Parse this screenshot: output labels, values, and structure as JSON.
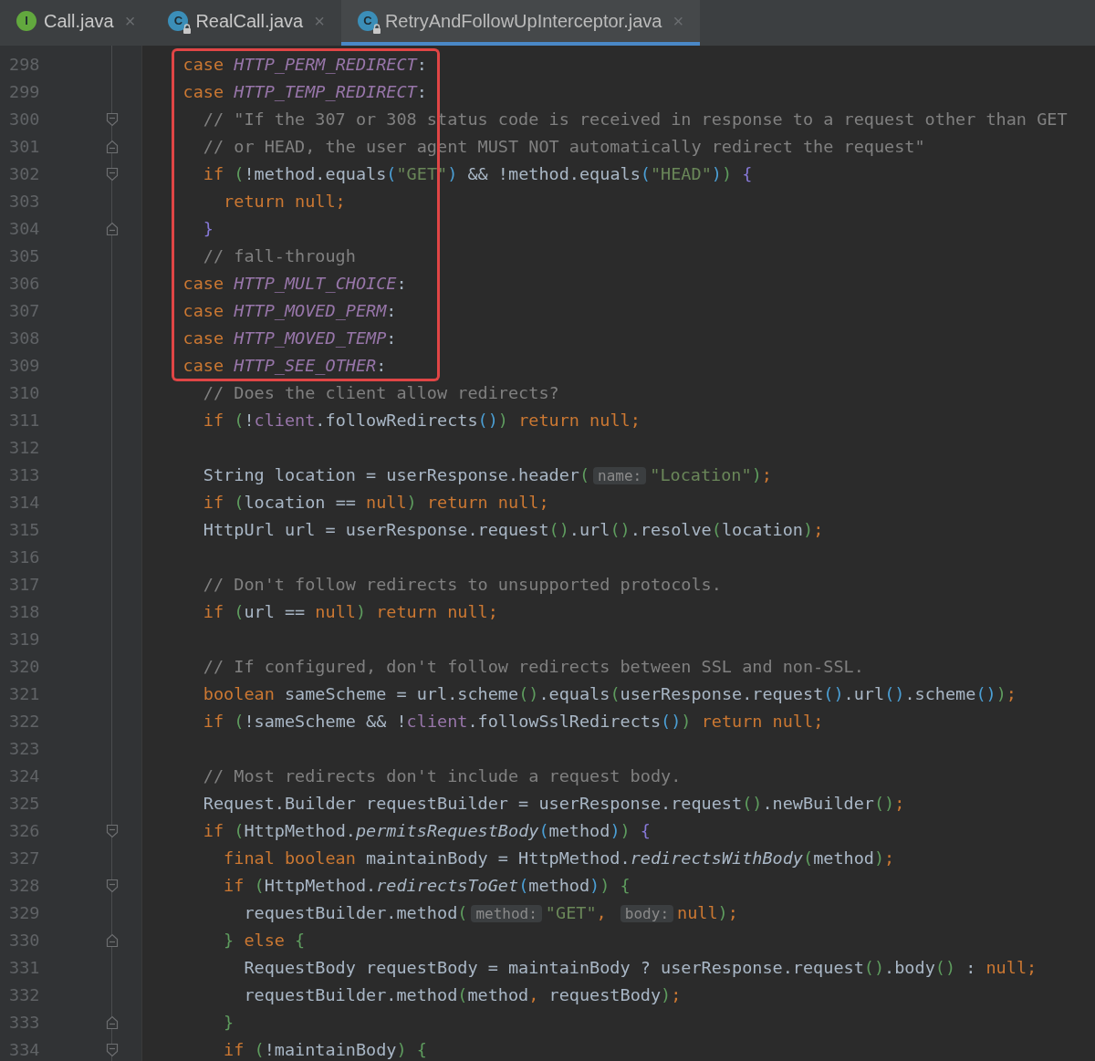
{
  "tabs": [
    {
      "label": "Call.java",
      "kind": "interface",
      "icon_letter": "I",
      "locked": false,
      "close": "×",
      "selected": false
    },
    {
      "label": "RealCall.java",
      "kind": "class",
      "icon_letter": "C",
      "locked": true,
      "close": "×",
      "selected": false
    },
    {
      "label": "RetryAndFollowUpInterceptor.java",
      "kind": "class",
      "icon_letter": "C",
      "locked": true,
      "close": "×",
      "selected": true
    }
  ],
  "lines": [
    {
      "number": "298",
      "highlighted": true,
      "tokens": [
        {
          "kind": "keyword",
          "text": "    case "
        },
        {
          "kind": "constant",
          "text": "HTTP_PERM_REDIRECT"
        },
        {
          "kind": "plain",
          "text": ":"
        }
      ]
    },
    {
      "number": "299",
      "highlighted": true,
      "tokens": [
        {
          "kind": "keyword",
          "text": "    case "
        },
        {
          "kind": "constant",
          "text": "HTTP_TEMP_REDIRECT"
        },
        {
          "kind": "plain",
          "text": ":"
        }
      ]
    },
    {
      "number": "300",
      "highlighted": true,
      "fold": {
        "kind": "open"
      },
      "tokens": [
        {
          "kind": "comment",
          "text": "      // \"If the 307 or 308 status code is received in response to a request other than GET"
        }
      ]
    },
    {
      "number": "301",
      "highlighted": true,
      "fold": {
        "kind": "close"
      },
      "tokens": [
        {
          "kind": "comment",
          "text": "      // or HEAD, the user agent MUST NOT automatically redirect the request\""
        }
      ]
    },
    {
      "number": "302",
      "highlighted": true,
      "fold": {
        "kind": "open"
      },
      "tokens": [
        {
          "kind": "keyword",
          "text": "      if "
        },
        {
          "kind": "bracket1",
          "text": "("
        },
        {
          "kind": "plain",
          "text": "!method.equals"
        },
        {
          "kind": "bracket2",
          "text": "("
        },
        {
          "kind": "string",
          "text": "\"GET\""
        },
        {
          "kind": "bracket2",
          "text": ")"
        },
        {
          "kind": "plain",
          "text": " && !method.equals"
        },
        {
          "kind": "bracket2",
          "text": "("
        },
        {
          "kind": "string",
          "text": "\"HEAD\""
        },
        {
          "kind": "bracket2",
          "text": ")"
        },
        {
          "kind": "bracket1",
          "text": ") "
        },
        {
          "kind": "bracket3",
          "text": "{"
        }
      ]
    },
    {
      "number": "303",
      "highlighted": true,
      "tokens": [
        {
          "kind": "keyword",
          "text": "        return null;"
        }
      ]
    },
    {
      "number": "304",
      "highlighted": true,
      "fold": {
        "kind": "close"
      },
      "tokens": [
        {
          "kind": "bracket3",
          "text": "      }"
        }
      ]
    },
    {
      "number": "305",
      "highlighted": true,
      "tokens": [
        {
          "kind": "comment",
          "text": "      // fall-through"
        }
      ]
    },
    {
      "number": "306",
      "highlighted": true,
      "tokens": [
        {
          "kind": "keyword",
          "text": "    case "
        },
        {
          "kind": "constant",
          "text": "HTTP_MULT_CHOICE"
        },
        {
          "kind": "plain",
          "text": ":"
        }
      ]
    },
    {
      "number": "307",
      "highlighted": true,
      "tokens": [
        {
          "kind": "keyword",
          "text": "    case "
        },
        {
          "kind": "constant",
          "text": "HTTP_MOVED_PERM"
        },
        {
          "kind": "plain",
          "text": ":"
        }
      ]
    },
    {
      "number": "308",
      "highlighted": true,
      "tokens": [
        {
          "kind": "keyword",
          "text": "    case "
        },
        {
          "kind": "constant",
          "text": "HTTP_MOVED_TEMP"
        },
        {
          "kind": "plain",
          "text": ":"
        }
      ]
    },
    {
      "number": "309",
      "highlighted": true,
      "tokens": [
        {
          "kind": "keyword",
          "text": "    case "
        },
        {
          "kind": "constant",
          "text": "HTTP_SEE_OTHER"
        },
        {
          "kind": "plain",
          "text": ":"
        }
      ]
    },
    {
      "number": "310",
      "highlighted": false,
      "tokens": [
        {
          "kind": "comment",
          "text": "      // Does the client allow redirects?"
        }
      ]
    },
    {
      "number": "311",
      "highlighted": false,
      "tokens": [
        {
          "kind": "keyword",
          "text": "      if "
        },
        {
          "kind": "bracket1",
          "text": "("
        },
        {
          "kind": "plain",
          "text": "!"
        },
        {
          "kind": "field",
          "text": "client"
        },
        {
          "kind": "plain",
          "text": ".followRedirects"
        },
        {
          "kind": "bracket2",
          "text": "()"
        },
        {
          "kind": "bracket1",
          "text": ") "
        },
        {
          "kind": "keyword",
          "text": "return null;"
        }
      ]
    },
    {
      "number": "312",
      "highlighted": false
    },
    {
      "number": "313",
      "highlighted": false,
      "tokens": [
        {
          "kind": "plain",
          "text": "      String location = userResponse.header"
        },
        {
          "kind": "bracket1",
          "text": "("
        },
        {
          "kind": "hint",
          "text": "name:"
        },
        {
          "kind": "string",
          "text": "\"Location\""
        },
        {
          "kind": "bracket1",
          "text": ")"
        },
        {
          "kind": "keyword",
          "text": ";"
        }
      ]
    },
    {
      "number": "314",
      "highlighted": false,
      "tokens": [
        {
          "kind": "keyword",
          "text": "      if "
        },
        {
          "kind": "bracket1",
          "text": "("
        },
        {
          "kind": "plain",
          "text": "location == "
        },
        {
          "kind": "keyword",
          "text": "null"
        },
        {
          "kind": "bracket1",
          "text": ") "
        },
        {
          "kind": "keyword",
          "text": "return null;"
        }
      ]
    },
    {
      "number": "315",
      "highlighted": false,
      "tokens": [
        {
          "kind": "plain",
          "text": "      HttpUrl url = userResponse.request"
        },
        {
          "kind": "bracket1",
          "text": "()"
        },
        {
          "kind": "plain",
          "text": ".url"
        },
        {
          "kind": "bracket1",
          "text": "()"
        },
        {
          "kind": "plain",
          "text": ".resolve"
        },
        {
          "kind": "bracket1",
          "text": "("
        },
        {
          "kind": "plain",
          "text": "location"
        },
        {
          "kind": "bracket1",
          "text": ")"
        },
        {
          "kind": "keyword",
          "text": ";"
        }
      ]
    },
    {
      "number": "316",
      "highlighted": false
    },
    {
      "number": "317",
      "highlighted": false,
      "tokens": [
        {
          "kind": "comment",
          "text": "      // Don't follow redirects to unsupported protocols."
        }
      ]
    },
    {
      "number": "318",
      "highlighted": false,
      "tokens": [
        {
          "kind": "keyword",
          "text": "      if "
        },
        {
          "kind": "bracket1",
          "text": "("
        },
        {
          "kind": "plain",
          "text": "url == "
        },
        {
          "kind": "keyword",
          "text": "null"
        },
        {
          "kind": "bracket1",
          "text": ") "
        },
        {
          "kind": "keyword",
          "text": "return null;"
        }
      ]
    },
    {
      "number": "319",
      "highlighted": false
    },
    {
      "number": "320",
      "highlighted": false,
      "tokens": [
        {
          "kind": "comment",
          "text": "      // If configured, don't follow redirects between SSL and non-SSL."
        }
      ]
    },
    {
      "number": "321",
      "highlighted": false,
      "tokens": [
        {
          "kind": "keyword",
          "text": "      boolean "
        },
        {
          "kind": "plain",
          "text": "sameScheme = url.scheme"
        },
        {
          "kind": "bracket1",
          "text": "()"
        },
        {
          "kind": "plain",
          "text": ".equals"
        },
        {
          "kind": "bracket1",
          "text": "("
        },
        {
          "kind": "plain",
          "text": "userResponse.request"
        },
        {
          "kind": "bracket2",
          "text": "()"
        },
        {
          "kind": "plain",
          "text": ".url"
        },
        {
          "kind": "bracket2",
          "text": "()"
        },
        {
          "kind": "plain",
          "text": ".scheme"
        },
        {
          "kind": "bracket2",
          "text": "()"
        },
        {
          "kind": "bracket1",
          "text": ")"
        },
        {
          "kind": "keyword",
          "text": ";"
        }
      ]
    },
    {
      "number": "322",
      "highlighted": false,
      "tokens": [
        {
          "kind": "keyword",
          "text": "      if "
        },
        {
          "kind": "bracket1",
          "text": "("
        },
        {
          "kind": "plain",
          "text": "!sameScheme && !"
        },
        {
          "kind": "field",
          "text": "client"
        },
        {
          "kind": "plain",
          "text": ".followSslRedirects"
        },
        {
          "kind": "bracket2",
          "text": "()"
        },
        {
          "kind": "bracket1",
          "text": ") "
        },
        {
          "kind": "keyword",
          "text": "return null;"
        }
      ]
    },
    {
      "number": "323",
      "highlighted": false
    },
    {
      "number": "324",
      "highlighted": false,
      "tokens": [
        {
          "kind": "comment",
          "text": "      // Most redirects don't include a request body."
        }
      ]
    },
    {
      "number": "325",
      "highlighted": false,
      "tokens": [
        {
          "kind": "plain",
          "text": "      Request.Builder requestBuilder = userResponse.request"
        },
        {
          "kind": "bracket1",
          "text": "()"
        },
        {
          "kind": "plain",
          "text": ".newBuilder"
        },
        {
          "kind": "bracket1",
          "text": "()"
        },
        {
          "kind": "keyword",
          "text": ";"
        }
      ]
    },
    {
      "number": "326",
      "highlighted": false,
      "fold": {
        "kind": "open"
      },
      "tokens": [
        {
          "kind": "keyword",
          "text": "      if "
        },
        {
          "kind": "bracket1",
          "text": "("
        },
        {
          "kind": "plain",
          "text": "HttpMethod."
        },
        {
          "kind": "method",
          "text": "permitsRequestBody"
        },
        {
          "kind": "bracket2",
          "text": "("
        },
        {
          "kind": "plain",
          "text": "method"
        },
        {
          "kind": "bracket2",
          "text": ")"
        },
        {
          "kind": "bracket1",
          "text": ") "
        },
        {
          "kind": "bracket3",
          "text": "{"
        }
      ]
    },
    {
      "number": "327",
      "highlighted": false,
      "tokens": [
        {
          "kind": "keyword",
          "text": "        final boolean "
        },
        {
          "kind": "plain",
          "text": "maintainBody = HttpMethod."
        },
        {
          "kind": "method",
          "text": "redirectsWithBody"
        },
        {
          "kind": "bracket1",
          "text": "("
        },
        {
          "kind": "plain",
          "text": "method"
        },
        {
          "kind": "bracket1",
          "text": ")"
        },
        {
          "kind": "keyword",
          "text": ";"
        }
      ]
    },
    {
      "number": "328",
      "highlighted": false,
      "fold": {
        "kind": "open"
      },
      "tokens": [
        {
          "kind": "keyword",
          "text": "        if "
        },
        {
          "kind": "bracket1",
          "text": "("
        },
        {
          "kind": "plain",
          "text": "HttpMethod."
        },
        {
          "kind": "method",
          "text": "redirectsToGet"
        },
        {
          "kind": "bracket2",
          "text": "("
        },
        {
          "kind": "plain",
          "text": "method"
        },
        {
          "kind": "bracket2",
          "text": ")"
        },
        {
          "kind": "bracket1",
          "text": ") {"
        }
      ]
    },
    {
      "number": "329",
      "highlighted": false,
      "tokens": [
        {
          "kind": "plain",
          "text": "          requestBuilder.method"
        },
        {
          "kind": "bracket1",
          "text": "("
        },
        {
          "kind": "hint",
          "text": "method:"
        },
        {
          "kind": "string",
          "text": "\"GET\""
        },
        {
          "kind": "keyword",
          "text": ", "
        },
        {
          "kind": "hint",
          "text": "body:"
        },
        {
          "kind": "keyword",
          "text": "null"
        },
        {
          "kind": "bracket1",
          "text": ")"
        },
        {
          "kind": "keyword",
          "text": ";"
        }
      ]
    },
    {
      "number": "330",
      "highlighted": false,
      "fold": {
        "kind": "close"
      },
      "tokens": [
        {
          "kind": "bracket1",
          "text": "        } "
        },
        {
          "kind": "keyword",
          "text": "else "
        },
        {
          "kind": "bracket1",
          "text": "{"
        }
      ]
    },
    {
      "number": "331",
      "highlighted": false,
      "tokens": [
        {
          "kind": "plain",
          "text": "          RequestBody requestBody = maintainBody ? userResponse.request"
        },
        {
          "kind": "bracket1",
          "text": "()"
        },
        {
          "kind": "plain",
          "text": ".body"
        },
        {
          "kind": "bracket1",
          "text": "()"
        },
        {
          "kind": "plain",
          "text": " : "
        },
        {
          "kind": "keyword",
          "text": "null;"
        }
      ]
    },
    {
      "number": "332",
      "highlighted": false,
      "tokens": [
        {
          "kind": "plain",
          "text": "          requestBuilder.method"
        },
        {
          "kind": "bracket1",
          "text": "("
        },
        {
          "kind": "plain",
          "text": "method"
        },
        {
          "kind": "keyword",
          "text": ", "
        },
        {
          "kind": "plain",
          "text": "requestBody"
        },
        {
          "kind": "bracket1",
          "text": ")"
        },
        {
          "kind": "keyword",
          "text": ";"
        }
      ]
    },
    {
      "number": "333",
      "highlighted": false,
      "fold": {
        "kind": "close"
      },
      "tokens": [
        {
          "kind": "bracket1",
          "text": "        }"
        }
      ]
    },
    {
      "number": "334",
      "highlighted": false,
      "fold": {
        "kind": "open"
      },
      "tokens": [
        {
          "kind": "keyword",
          "text": "        if "
        },
        {
          "kind": "bracket1",
          "text": "("
        },
        {
          "kind": "plain",
          "text": "!maintainBody"
        },
        {
          "kind": "bracket1",
          "text": ") {"
        }
      ]
    }
  ]
}
